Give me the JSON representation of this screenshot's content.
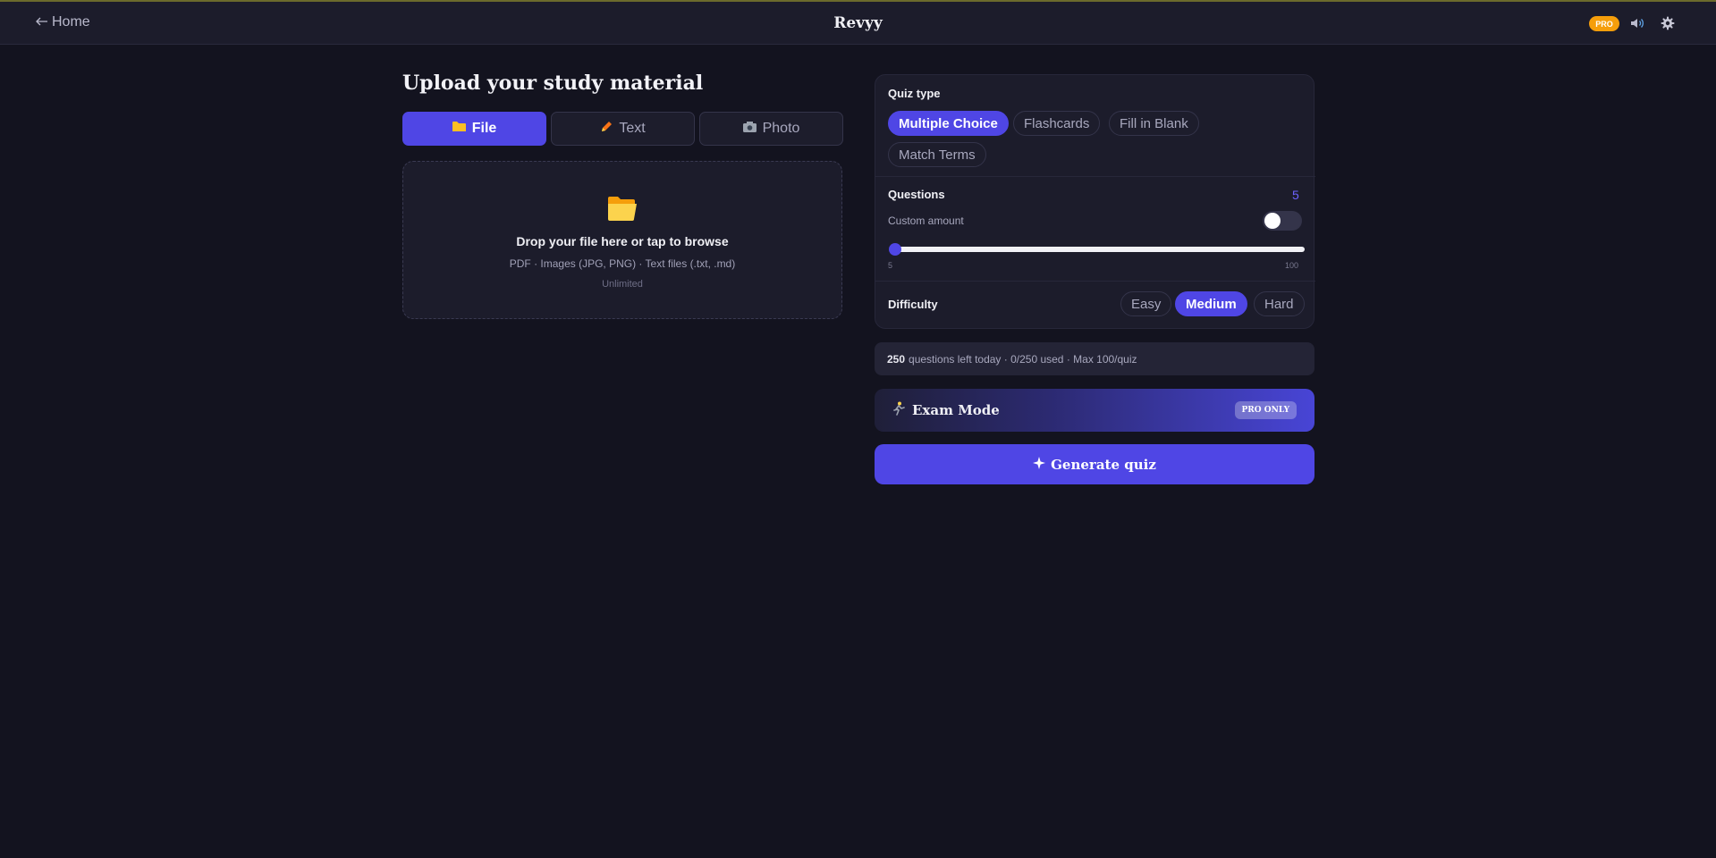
{
  "header": {
    "back_label": "Home",
    "brand": "Revyy",
    "pro_badge": "PRO"
  },
  "upload": {
    "title": "Upload your study material",
    "tabs": [
      {
        "label": "File",
        "icon": "folder-icon",
        "active": true
      },
      {
        "label": "Text",
        "icon": "pencil-icon",
        "active": false
      },
      {
        "label": "Photo",
        "icon": "camera-icon",
        "active": false
      }
    ],
    "dropzone": {
      "title": "Drop your file here or tap to browse",
      "formats": "PDF · Images (JPG, PNG) · Text files (.txt, .md)",
      "limit": "Unlimited"
    }
  },
  "quiz_type": {
    "label": "Quiz type",
    "options": [
      {
        "label": "Multiple Choice",
        "active": true
      },
      {
        "label": "Flashcards",
        "active": false
      },
      {
        "label": "Fill in Blank",
        "active": false
      },
      {
        "label": "Match Terms",
        "active": false
      }
    ]
  },
  "questions": {
    "label": "Questions",
    "count": "5",
    "custom_label": "Custom amount",
    "custom_enabled": false,
    "slider_min": "5",
    "slider_max": "100",
    "slider_value": 5
  },
  "difficulty": {
    "label": "Difficulty",
    "options": [
      {
        "label": "Easy",
        "active": false
      },
      {
        "label": "Medium",
        "active": true
      },
      {
        "label": "Hard",
        "active": false
      }
    ]
  },
  "usage": {
    "count": "250",
    "text": "questions left today · 0/250 used · Max 100/quiz"
  },
  "exam_mode": {
    "label": "Exam Mode",
    "badge": "PRO ONLY",
    "icon": "runner-icon"
  },
  "generate": {
    "label": "Generate quiz",
    "icon": "sparkle-icon"
  },
  "colors": {
    "accent": "#4f46e5",
    "background": "#13131f",
    "pro_badge": "#f59e0b"
  }
}
